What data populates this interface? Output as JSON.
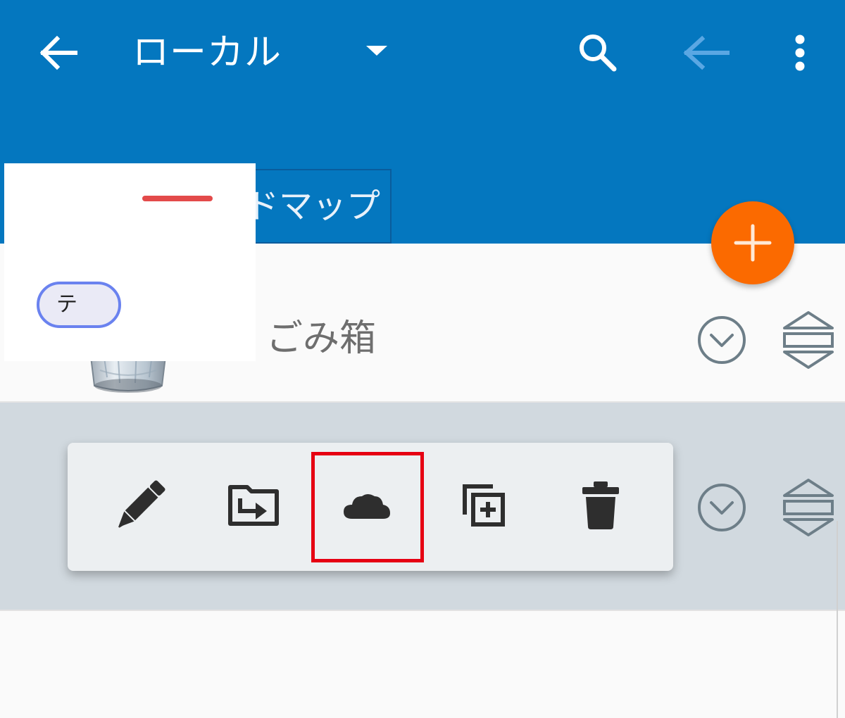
{
  "appbar": {
    "title": "ローカル",
    "background": "#0477bf",
    "icons": [
      "back-arrow-icon",
      "dropdown-triangle-icon",
      "search-icon",
      "nav-back-icon",
      "more-vertical-icon"
    ]
  },
  "breadcrumb": {
    "root_icon": "app-logo-icon",
    "items": [
      {
        "label": "マインドマップ"
      }
    ]
  },
  "fab": {
    "icon": "plus-icon",
    "color": "#fb6a00"
  },
  "list": {
    "items": [
      {
        "label": "ごみ箱",
        "icon": "recycle-bin-icon"
      },
      {
        "label": "",
        "thumbnail_node_text": "テ"
      }
    ]
  },
  "context_menu": {
    "items": [
      {
        "icon": "pencil-icon"
      },
      {
        "icon": "move-to-folder-icon"
      },
      {
        "icon": "cloud-icon",
        "highlighted": true
      },
      {
        "icon": "duplicate-icon"
      },
      {
        "icon": "trash-can-icon"
      }
    ],
    "highlight_color": "#e60012"
  }
}
